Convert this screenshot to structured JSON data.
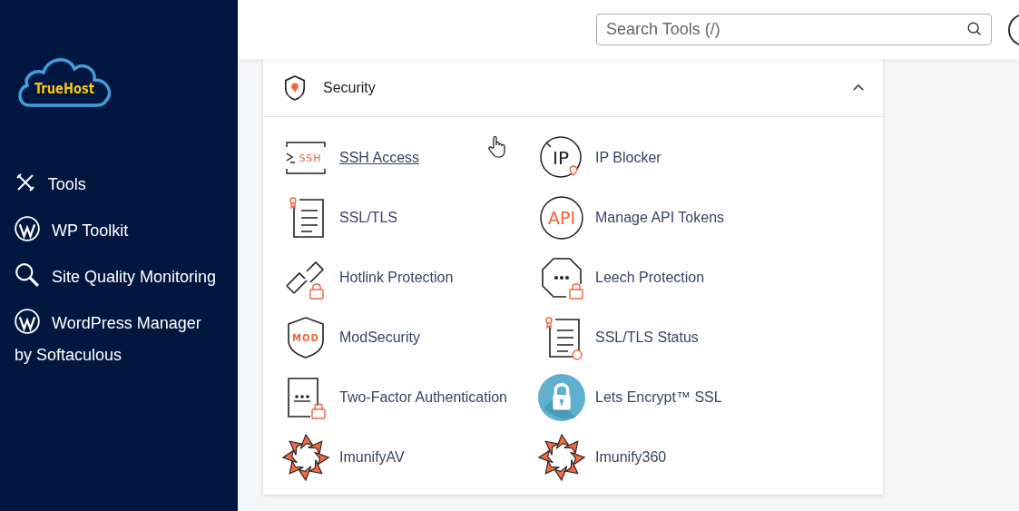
{
  "logo": {
    "text": "TrueHost"
  },
  "sidebar": {
    "items": [
      {
        "label": "Tools",
        "kind": "tools"
      },
      {
        "label": "WP Toolkit",
        "kind": "wordpress"
      },
      {
        "label": "Site Quality Monitoring",
        "kind": "search"
      },
      {
        "label": "WordPress Manager by Softaculous",
        "kind": "wordpress"
      }
    ]
  },
  "search": {
    "placeholder": "Search Tools (/)"
  },
  "section": {
    "title": "Security",
    "expanded": true,
    "items": [
      {
        "label": "SSH Access",
        "kind": "ssh",
        "icon_text": "SSH",
        "hovered": true
      },
      {
        "label": "IP Blocker",
        "kind": "ipblock",
        "icon_text": "IP",
        "hovered": false
      },
      {
        "label": "SSL/TLS",
        "kind": "cert",
        "hovered": false
      },
      {
        "label": "Manage API Tokens",
        "kind": "api",
        "icon_text": "API",
        "hovered": false
      },
      {
        "label": "Hotlink Protection",
        "kind": "hotlink",
        "hovered": false
      },
      {
        "label": "Leech Protection",
        "kind": "leech",
        "hovered": false
      },
      {
        "label": "ModSecurity",
        "kind": "mod",
        "icon_text": "MOD",
        "hovered": false
      },
      {
        "label": "SSL/TLS Status",
        "kind": "certstatus",
        "hovered": false
      },
      {
        "label": "Two-Factor Authentication",
        "kind": "twofa",
        "hovered": false
      },
      {
        "label": "Lets Encrypt™ SSL",
        "kind": "letsencrypt",
        "hovered": false
      },
      {
        "label": "ImunifyAV",
        "kind": "imunify",
        "hovered": false
      },
      {
        "label": "Imunify360",
        "kind": "imunify",
        "hovered": false
      }
    ]
  }
}
